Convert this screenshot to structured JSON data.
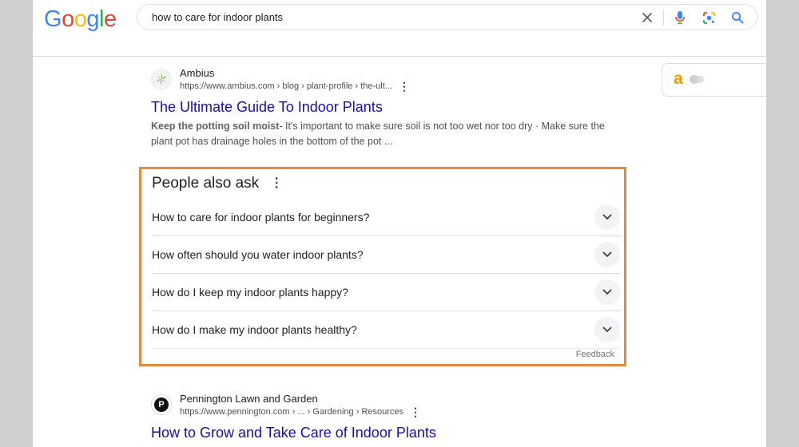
{
  "colors": {
    "accent_highlight": "#e8883a",
    "link_title": "#1a0dab",
    "google_blue": "#4285f4",
    "google_red": "#ea4335",
    "google_yellow": "#fbbc05",
    "google_green": "#34a853",
    "extension_orange": "#f29900"
  },
  "header": {
    "logo_letters": [
      "G",
      "o",
      "o",
      "g",
      "l",
      "e"
    ],
    "search": {
      "value": "how to care for indoor plants",
      "icons": [
        "close-icon",
        "mic-icon",
        "lens-icon",
        "search-icon"
      ]
    }
  },
  "extension": {
    "logo_text": "a"
  },
  "results": [
    {
      "site_name": "Ambius",
      "url": "https://www.ambius.com › blog › plant-profile › the-ult...",
      "title": "The Ultimate Guide To Indoor Plants",
      "snippet_bold": "Keep the potting soil moist",
      "snippet_rest": "- It's important to make sure soil is not too wet nor too dry · Make sure the plant pot has drainage holes in the bottom of the pot ..."
    },
    {
      "site_name": "Pennington Lawn and Garden",
      "url": "https://www.pennington.com › ... › Gardening › Resources",
      "title": "How to Grow and Take Care of Indoor Plants",
      "favicon_letter": "P"
    }
  ],
  "people_also_ask": {
    "heading": "People also ask",
    "questions": [
      "How to care for indoor plants for beginners?",
      "How often should you water indoor plants?",
      "How do I keep my indoor plants happy?",
      "How do I make my indoor plants healthy?"
    ],
    "feedback_label": "Feedback"
  }
}
